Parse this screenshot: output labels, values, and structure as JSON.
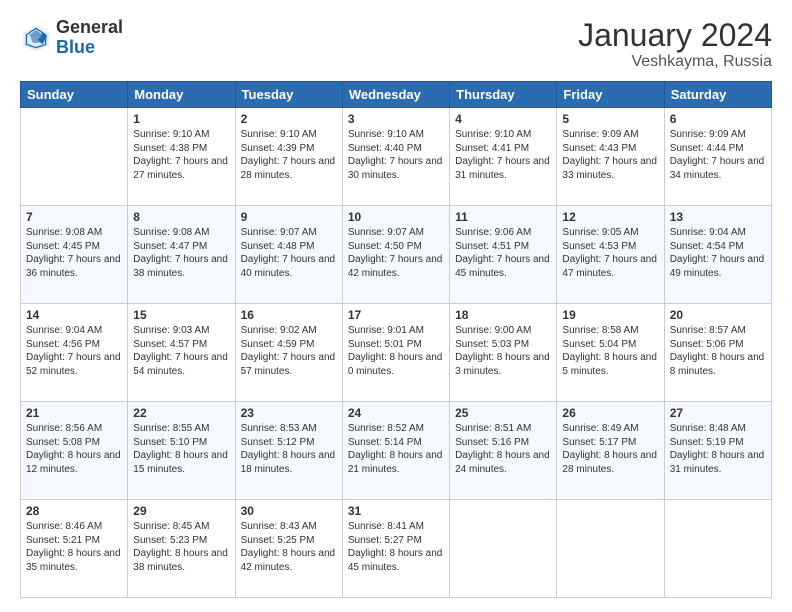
{
  "header": {
    "logo_general": "General",
    "logo_blue": "Blue",
    "main_title": "January 2024",
    "subtitle": "Veshkayma, Russia"
  },
  "days_of_week": [
    "Sunday",
    "Monday",
    "Tuesday",
    "Wednesday",
    "Thursday",
    "Friday",
    "Saturday"
  ],
  "weeks": [
    [
      {
        "day": "",
        "sunrise": "",
        "sunset": "",
        "daylight": ""
      },
      {
        "day": "1",
        "sunrise": "Sunrise: 9:10 AM",
        "sunset": "Sunset: 4:38 PM",
        "daylight": "Daylight: 7 hours and 27 minutes."
      },
      {
        "day": "2",
        "sunrise": "Sunrise: 9:10 AM",
        "sunset": "Sunset: 4:39 PM",
        "daylight": "Daylight: 7 hours and 28 minutes."
      },
      {
        "day": "3",
        "sunrise": "Sunrise: 9:10 AM",
        "sunset": "Sunset: 4:40 PM",
        "daylight": "Daylight: 7 hours and 30 minutes."
      },
      {
        "day": "4",
        "sunrise": "Sunrise: 9:10 AM",
        "sunset": "Sunset: 4:41 PM",
        "daylight": "Daylight: 7 hours and 31 minutes."
      },
      {
        "day": "5",
        "sunrise": "Sunrise: 9:09 AM",
        "sunset": "Sunset: 4:43 PM",
        "daylight": "Daylight: 7 hours and 33 minutes."
      },
      {
        "day": "6",
        "sunrise": "Sunrise: 9:09 AM",
        "sunset": "Sunset: 4:44 PM",
        "daylight": "Daylight: 7 hours and 34 minutes."
      }
    ],
    [
      {
        "day": "7",
        "sunrise": "Sunrise: 9:08 AM",
        "sunset": "Sunset: 4:45 PM",
        "daylight": "Daylight: 7 hours and 36 minutes."
      },
      {
        "day": "8",
        "sunrise": "Sunrise: 9:08 AM",
        "sunset": "Sunset: 4:47 PM",
        "daylight": "Daylight: 7 hours and 38 minutes."
      },
      {
        "day": "9",
        "sunrise": "Sunrise: 9:07 AM",
        "sunset": "Sunset: 4:48 PM",
        "daylight": "Daylight: 7 hours and 40 minutes."
      },
      {
        "day": "10",
        "sunrise": "Sunrise: 9:07 AM",
        "sunset": "Sunset: 4:50 PM",
        "daylight": "Daylight: 7 hours and 42 minutes."
      },
      {
        "day": "11",
        "sunrise": "Sunrise: 9:06 AM",
        "sunset": "Sunset: 4:51 PM",
        "daylight": "Daylight: 7 hours and 45 minutes."
      },
      {
        "day": "12",
        "sunrise": "Sunrise: 9:05 AM",
        "sunset": "Sunset: 4:53 PM",
        "daylight": "Daylight: 7 hours and 47 minutes."
      },
      {
        "day": "13",
        "sunrise": "Sunrise: 9:04 AM",
        "sunset": "Sunset: 4:54 PM",
        "daylight": "Daylight: 7 hours and 49 minutes."
      }
    ],
    [
      {
        "day": "14",
        "sunrise": "Sunrise: 9:04 AM",
        "sunset": "Sunset: 4:56 PM",
        "daylight": "Daylight: 7 hours and 52 minutes."
      },
      {
        "day": "15",
        "sunrise": "Sunrise: 9:03 AM",
        "sunset": "Sunset: 4:57 PM",
        "daylight": "Daylight: 7 hours and 54 minutes."
      },
      {
        "day": "16",
        "sunrise": "Sunrise: 9:02 AM",
        "sunset": "Sunset: 4:59 PM",
        "daylight": "Daylight: 7 hours and 57 minutes."
      },
      {
        "day": "17",
        "sunrise": "Sunrise: 9:01 AM",
        "sunset": "Sunset: 5:01 PM",
        "daylight": "Daylight: 8 hours and 0 minutes."
      },
      {
        "day": "18",
        "sunrise": "Sunrise: 9:00 AM",
        "sunset": "Sunset: 5:03 PM",
        "daylight": "Daylight: 8 hours and 3 minutes."
      },
      {
        "day": "19",
        "sunrise": "Sunrise: 8:58 AM",
        "sunset": "Sunset: 5:04 PM",
        "daylight": "Daylight: 8 hours and 5 minutes."
      },
      {
        "day": "20",
        "sunrise": "Sunrise: 8:57 AM",
        "sunset": "Sunset: 5:06 PM",
        "daylight": "Daylight: 8 hours and 8 minutes."
      }
    ],
    [
      {
        "day": "21",
        "sunrise": "Sunrise: 8:56 AM",
        "sunset": "Sunset: 5:08 PM",
        "daylight": "Daylight: 8 hours and 12 minutes."
      },
      {
        "day": "22",
        "sunrise": "Sunrise: 8:55 AM",
        "sunset": "Sunset: 5:10 PM",
        "daylight": "Daylight: 8 hours and 15 minutes."
      },
      {
        "day": "23",
        "sunrise": "Sunrise: 8:53 AM",
        "sunset": "Sunset: 5:12 PM",
        "daylight": "Daylight: 8 hours and 18 minutes."
      },
      {
        "day": "24",
        "sunrise": "Sunrise: 8:52 AM",
        "sunset": "Sunset: 5:14 PM",
        "daylight": "Daylight: 8 hours and 21 minutes."
      },
      {
        "day": "25",
        "sunrise": "Sunrise: 8:51 AM",
        "sunset": "Sunset: 5:16 PM",
        "daylight": "Daylight: 8 hours and 24 minutes."
      },
      {
        "day": "26",
        "sunrise": "Sunrise: 8:49 AM",
        "sunset": "Sunset: 5:17 PM",
        "daylight": "Daylight: 8 hours and 28 minutes."
      },
      {
        "day": "27",
        "sunrise": "Sunrise: 8:48 AM",
        "sunset": "Sunset: 5:19 PM",
        "daylight": "Daylight: 8 hours and 31 minutes."
      }
    ],
    [
      {
        "day": "28",
        "sunrise": "Sunrise: 8:46 AM",
        "sunset": "Sunset: 5:21 PM",
        "daylight": "Daylight: 8 hours and 35 minutes."
      },
      {
        "day": "29",
        "sunrise": "Sunrise: 8:45 AM",
        "sunset": "Sunset: 5:23 PM",
        "daylight": "Daylight: 8 hours and 38 minutes."
      },
      {
        "day": "30",
        "sunrise": "Sunrise: 8:43 AM",
        "sunset": "Sunset: 5:25 PM",
        "daylight": "Daylight: 8 hours and 42 minutes."
      },
      {
        "day": "31",
        "sunrise": "Sunrise: 8:41 AM",
        "sunset": "Sunset: 5:27 PM",
        "daylight": "Daylight: 8 hours and 45 minutes."
      },
      {
        "day": "",
        "sunrise": "",
        "sunset": "",
        "daylight": ""
      },
      {
        "day": "",
        "sunrise": "",
        "sunset": "",
        "daylight": ""
      },
      {
        "day": "",
        "sunrise": "",
        "sunset": "",
        "daylight": ""
      }
    ]
  ]
}
